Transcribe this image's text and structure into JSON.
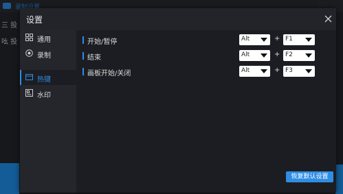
{
  "background_app": {
    "title": "录制设置",
    "side_items": [
      "三 投",
      "吆 投"
    ]
  },
  "dialog": {
    "title": "设置",
    "close_icon": "close-icon"
  },
  "sidebar": {
    "items": [
      {
        "label": "通用",
        "icon": "grid-icon",
        "active": false
      },
      {
        "label": "录制",
        "icon": "record-icon",
        "active": false
      },
      {
        "label": "热键",
        "icon": "keyboard-icon",
        "active": true
      },
      {
        "label": "水印",
        "icon": "watermark-icon",
        "active": false
      }
    ]
  },
  "hotkeys": {
    "plus": "+",
    "rows": [
      {
        "label": "开始/暂停",
        "modifier": "Alt",
        "key": "F1"
      },
      {
        "label": "结束",
        "modifier": "Alt",
        "key": "F2"
      },
      {
        "label": "画板开始/关闭",
        "modifier": "Alt",
        "key": "F3"
      }
    ]
  },
  "restore_button": "恢复默认设置",
  "colors": {
    "accent": "#2f8de4",
    "dialog_bg": "#1c1d22",
    "sidebar_bg": "#25262c"
  }
}
